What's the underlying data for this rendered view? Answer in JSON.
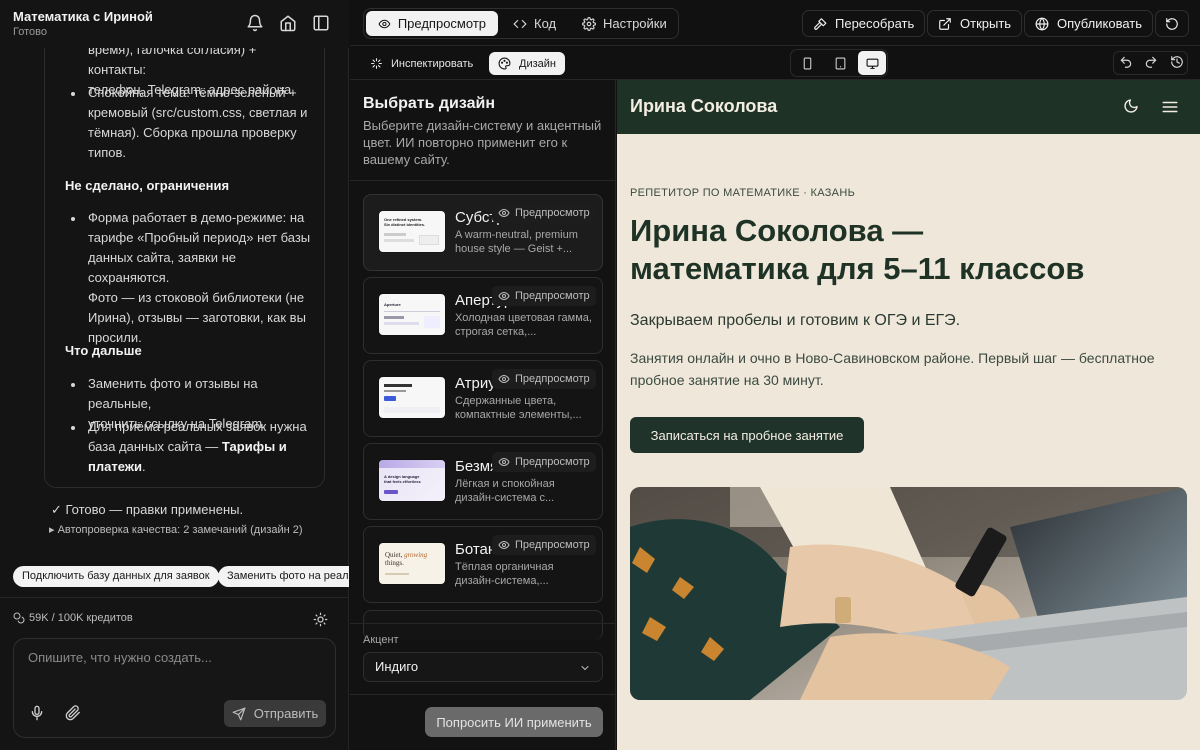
{
  "chat": {
    "title": "Математика с Ириной",
    "status": "Готово",
    "message": {
      "intro_lines": [
        "время), галочка согласия) + контакты:",
        "телефон, Telegram, адрес района."
      ],
      "theme_item": [
        "Спокойная тема: тёмно-зелёный +",
        "кремовый (src/custom.css, светлая и",
        "тёмная). Сборка прошла проверку",
        "типов."
      ],
      "limits_heading": "Не сделано, ограничения",
      "limits_item": [
        "Форма работает в демо-режиме: на",
        "тарифе «Пробный период» нет базы",
        "данных сайта, заявки не сохраняются.",
        "Фото — из стоковой библиотеки (не",
        "Ирина), отзывы — заготовки, как вы",
        "просили."
      ],
      "next_heading": "Что дальше",
      "next_item1": [
        "Заменить фото и отзывы на реальные,",
        "уточнить ссылку на Telegram."
      ],
      "next_item2_lines": [
        "Для приёма реальных заявок нужна",
        "база данных сайта — "
      ],
      "next_item2_strong1": "Тарифы и",
      "next_item2_strong2": "платежи",
      "next_item2_end": "."
    },
    "done_text": "✓ Готово — правки применены.",
    "autocheck_text": "▸ Автопроверка качества: 2 замечаний (дизайн 2)",
    "suggestions": [
      "Подключить базу данных для заявок",
      "Заменить фото на реальн"
    ],
    "credits": "59K / 100K кредитов",
    "input_placeholder": "Опишите, что нужно создать...",
    "send_label": "Отправить"
  },
  "toolbar": {
    "tabs": [
      "Предпросмотр",
      "Код",
      "Настройки"
    ],
    "rebuild": "Пересобрать",
    "open": "Открыть",
    "publish": "Опубликовать"
  },
  "subbar": {
    "inspect": "Инспектировать",
    "design": "Дизайн"
  },
  "design_panel": {
    "title": "Выбрать дизайн",
    "description": "Выберите дизайн-систему и акцентный цвет. ИИ повторно применит его к вашему сайту.",
    "preview_label": "Предпросмотр",
    "cards": [
      {
        "name": "Субстрат",
        "desc": "A warm-neutral, premium house style — Geist +..."
      },
      {
        "name": "Апертура",
        "desc": "Холодная цветовая гамма, строгая сетка,..."
      },
      {
        "name": "Атриум",
        "desc": "Сдержанные цвета, компактные элементы,..."
      },
      {
        "name": "Безмятежность",
        "desc": "Лёгкая и спокойная дизайн-система с..."
      },
      {
        "name": "Ботаника",
        "desc": "Тёплая органичная дизайн-система,..."
      }
    ],
    "thumb_texts": [
      "One refined system. Six distinct identities.",
      "Aperture",
      "A design language that feels effortless",
      "Quiet,",
      "growing",
      "things."
    ],
    "accent_label": "Акцент",
    "accent_value": "Индиго",
    "apply_label": "Попросить ИИ применить"
  },
  "site": {
    "brand": "Ирина Соколова",
    "kicker": "РЕПЕТИТОР ПО МАТЕМАТИКЕ · КАЗАНЬ",
    "headline_line1": "Ирина Соколова —",
    "headline_line2": "математика для 5–11 классов",
    "lead": "Закрываем пробелы и готовим к ОГЭ и ЕГЭ.",
    "paragraph": "Занятия онлайн и очно в Ново-Савиновском районе. Первый шаг — бесплатное пробное занятие на 30 минут.",
    "cta": "Записаться на пробное занятие",
    "colors": {
      "header": "#1e3326",
      "background": "#efe8da",
      "cta": "#20332a"
    }
  }
}
